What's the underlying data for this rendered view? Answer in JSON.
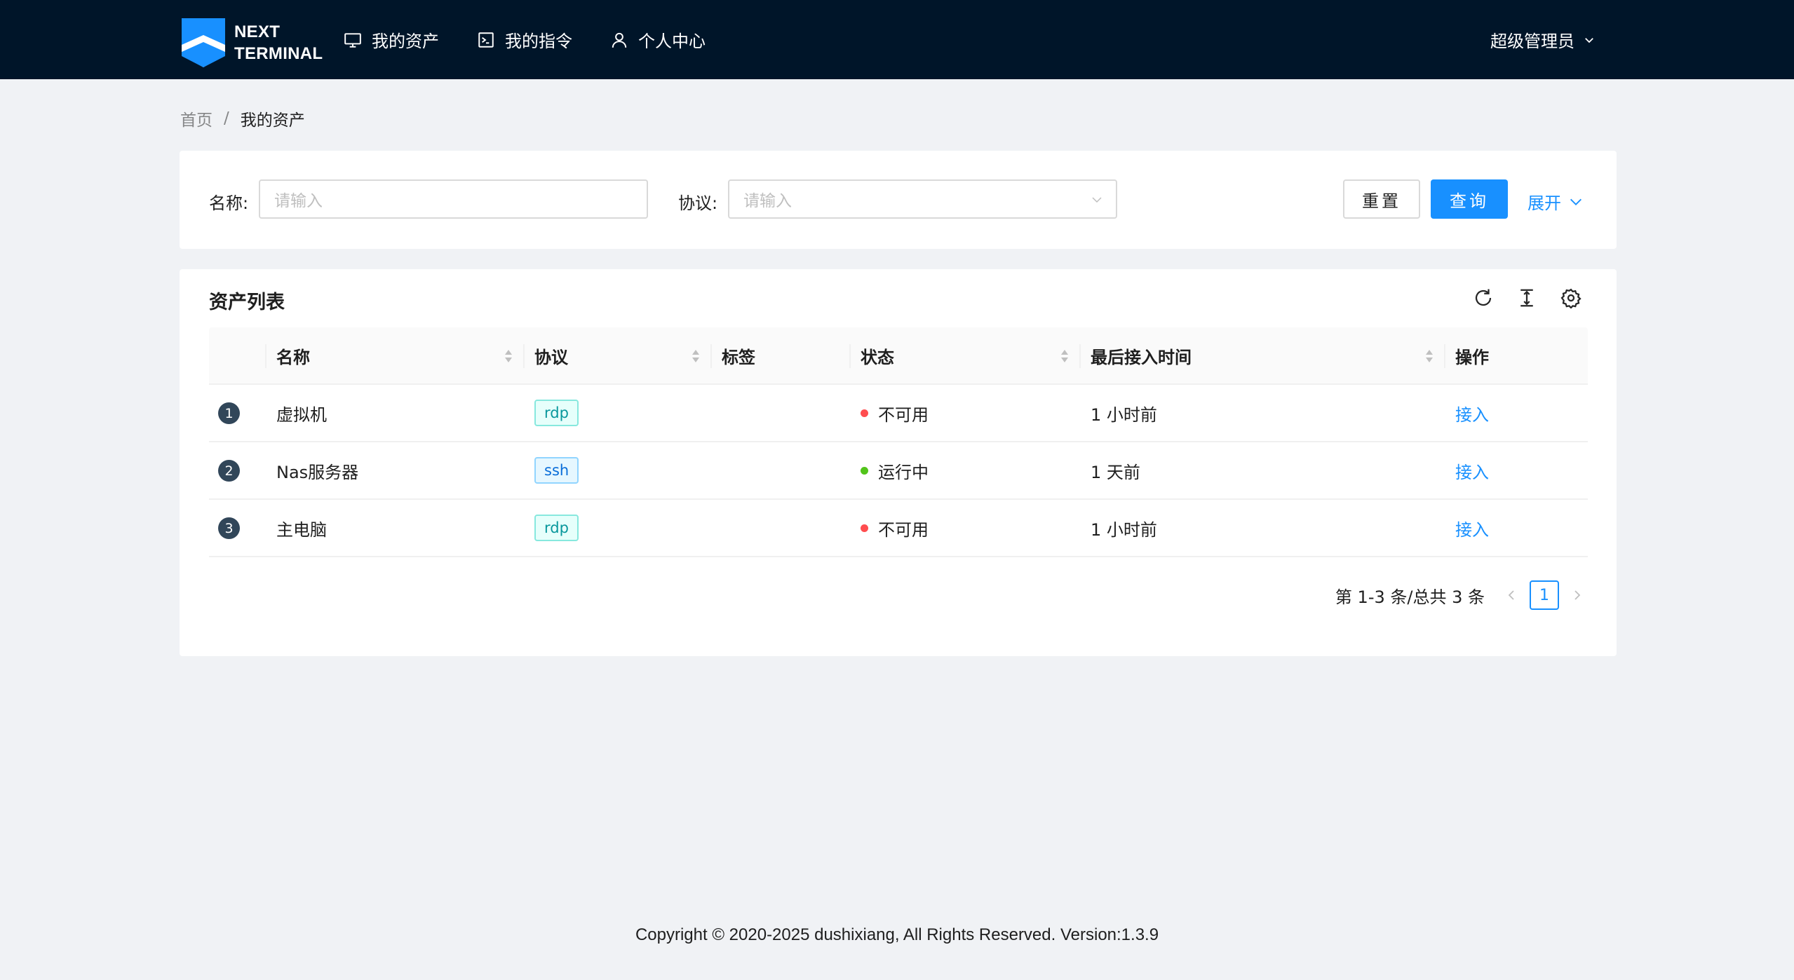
{
  "brand": {
    "line1": "NEXT",
    "line2": "TERMINAL"
  },
  "nav": [
    {
      "label": "我的资产",
      "icon": "desktop-icon"
    },
    {
      "label": "我的指令",
      "icon": "code-icon"
    },
    {
      "label": "个人中心",
      "icon": "user-icon"
    }
  ],
  "user_menu": {
    "label": "超级管理员",
    "icon": "chevron-down-icon"
  },
  "breadcrumb": {
    "home": "首页",
    "separator": "/",
    "current": "我的资产"
  },
  "search": {
    "name_label": "名称:",
    "name_placeholder": "请输入",
    "protocol_label": "协议:",
    "protocol_placeholder": "请输入",
    "reset_label": "重置",
    "query_label": "查询",
    "expand_label": "展开"
  },
  "table": {
    "title": "资产列表",
    "columns": [
      "名称",
      "协议",
      "标签",
      "状态",
      "最后接入时间",
      "操作"
    ],
    "rows": [
      {
        "index": "1",
        "name": "虚拟机",
        "protocol": "rdp",
        "tag": "",
        "status": "不可用",
        "status_color": "#ff4d4f",
        "last_access": "1 小时前",
        "action": "接入"
      },
      {
        "index": "2",
        "name": "Nas服务器",
        "protocol": "ssh",
        "tag": "",
        "status": "运行中",
        "status_color": "#52c41a",
        "last_access": "1 天前",
        "action": "接入"
      },
      {
        "index": "3",
        "name": "主电脑",
        "protocol": "rdp",
        "tag": "",
        "status": "不可用",
        "status_color": "#ff4d4f",
        "last_access": "1 小时前",
        "action": "接入"
      }
    ]
  },
  "pagination": {
    "summary": "第 1-3 条/总共 3 条",
    "current_page": "1"
  },
  "footer": {
    "text": "Copyright © 2020-2025 dushixiang, All Rights Reserved. Version:1.3.9"
  },
  "colors": {
    "header_bg": "#001529",
    "primary": "#1890ff",
    "page_bg": "#f0f2f5"
  }
}
